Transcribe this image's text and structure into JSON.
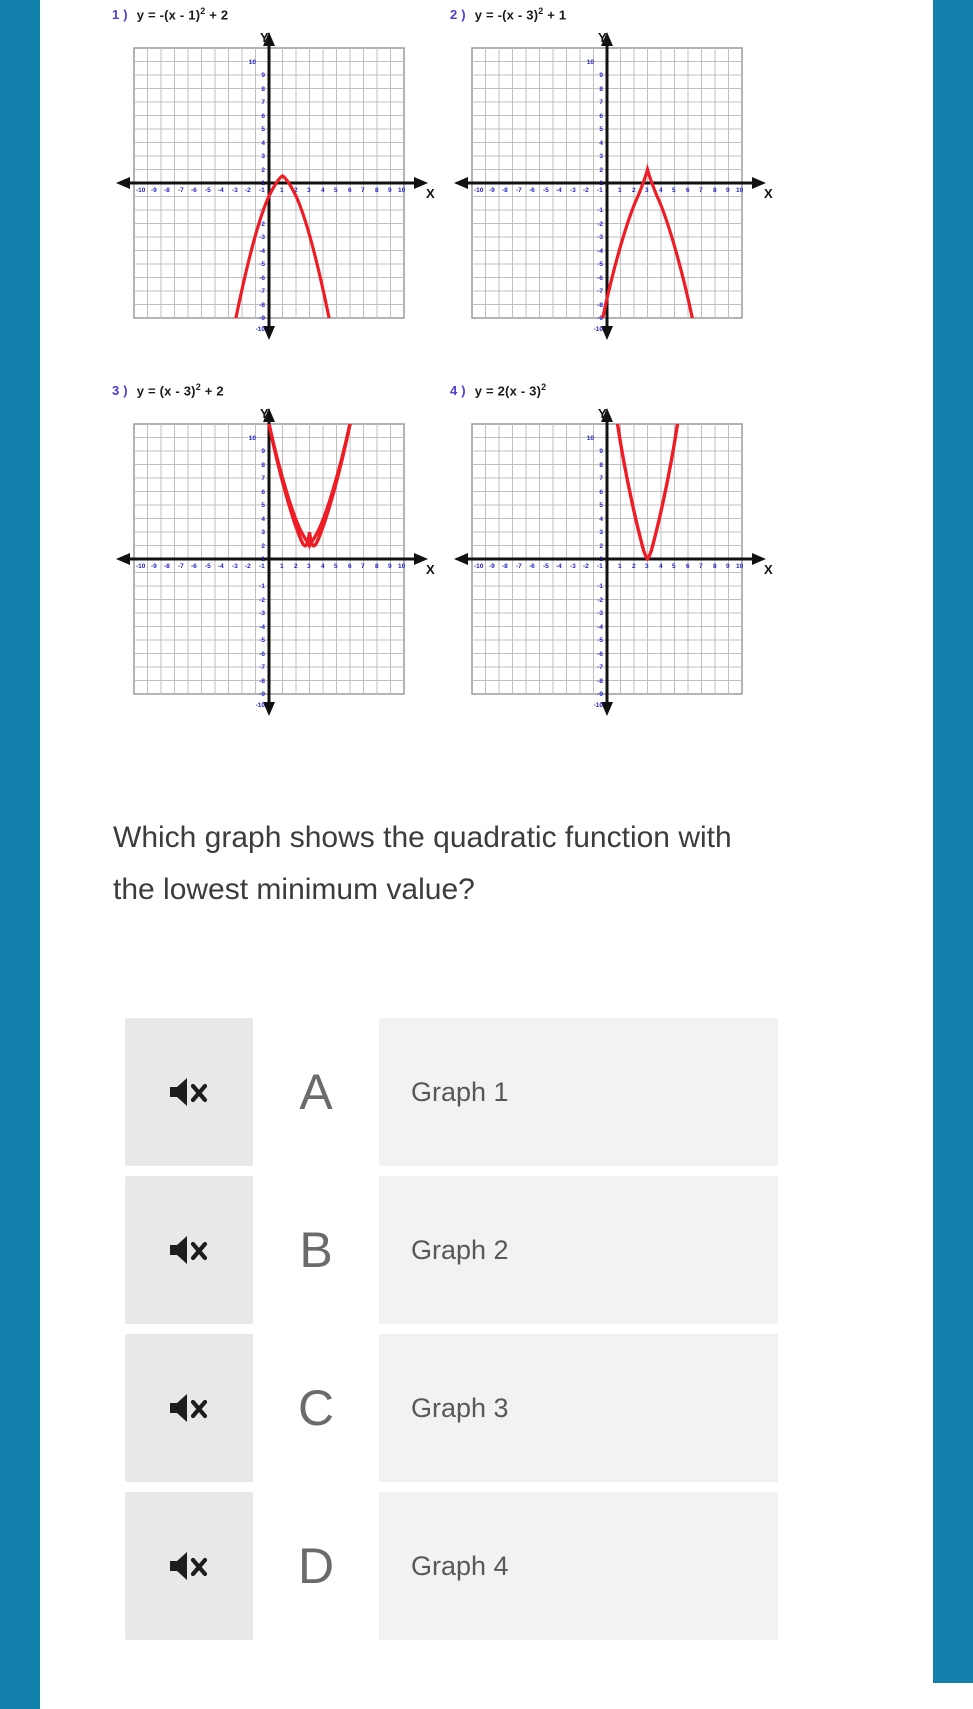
{
  "theme": {
    "rail_color": "#1180ab",
    "curve_color": "#ee1c25",
    "label_blue": "#4a3fd0",
    "tick_blue": "#2222cc",
    "grid_color": "#b3b3b3",
    "axis_color": "#1a1a1a",
    "question_color": "#3c3c3c"
  },
  "worksheet": {
    "axis_labels": {
      "x": "X",
      "y": "Y"
    },
    "graphs": [
      {
        "number": "1 )",
        "equation_prefix": "y = -(x - 1)",
        "equation_exponent": "2",
        "equation_suffix": " + 2",
        "equation_plain": "y = -(x - 1)^2 + 2"
      },
      {
        "number": "2 )",
        "equation_prefix": "y = -(x - 3)",
        "equation_exponent": "2",
        "equation_suffix": " + 1",
        "equation_plain": "y = -(x - 3)^2 + 1"
      },
      {
        "number": "3 )",
        "equation_prefix": "y = (x - 3)",
        "equation_exponent": "2",
        "equation_suffix": " + 2",
        "equation_plain": "y = (x - 3)^2 + 2"
      },
      {
        "number": "4 )",
        "equation_prefix": "y = 2(x - 3)",
        "equation_exponent": "2",
        "equation_suffix": "",
        "equation_plain": "y = 2(x - 3)^2"
      }
    ]
  },
  "chart_data": [
    {
      "type": "line",
      "title": "y = -(x - 1)^2 + 2",
      "xlabel": "X",
      "ylabel": "Y",
      "xlim": [
        -10,
        10
      ],
      "ylim": [
        -10,
        10
      ],
      "grid": true,
      "x_ticks": [
        -10,
        -9,
        -8,
        -7,
        -6,
        -5,
        -4,
        -3,
        -2,
        -1,
        1,
        2,
        3,
        4,
        5,
        6,
        7,
        8,
        9,
        10
      ],
      "y_ticks": [
        -10,
        -9,
        -8,
        -7,
        -6,
        -5,
        -4,
        -3,
        -2,
        -1,
        1,
        2,
        3,
        4,
        5,
        6,
        7,
        8,
        9,
        10
      ],
      "function": {
        "a": -1,
        "h": 1,
        "k": 2
      },
      "vertex": [
        1,
        2
      ],
      "opens": "down",
      "x_intercepts": [
        -0.41,
        2.41
      ]
    },
    {
      "type": "line",
      "title": "y = -(x - 3)^2 + 1",
      "xlabel": "X",
      "ylabel": "Y",
      "xlim": [
        -10,
        10
      ],
      "ylim": [
        -10,
        10
      ],
      "grid": true,
      "x_ticks": [
        -10,
        -9,
        -8,
        -7,
        -6,
        -5,
        -4,
        -3,
        -2,
        -1,
        1,
        2,
        3,
        4,
        5,
        6,
        7,
        8,
        9,
        10
      ],
      "y_ticks": [
        -10,
        -9,
        -8,
        -7,
        -6,
        -5,
        -4,
        -3,
        -2,
        -1,
        1,
        2,
        3,
        4,
        5,
        6,
        7,
        8,
        9,
        10
      ],
      "function": {
        "a": -1,
        "h": 3,
        "k": 1
      },
      "vertex": [
        3,
        1
      ],
      "opens": "down",
      "x_intercepts": [
        2,
        4
      ]
    },
    {
      "type": "line",
      "title": "y = (x - 3)^2 + 2",
      "xlabel": "X",
      "ylabel": "Y",
      "xlim": [
        -10,
        10
      ],
      "ylim": [
        -10,
        10
      ],
      "grid": true,
      "x_ticks": [
        -10,
        -9,
        -8,
        -7,
        -6,
        -5,
        -4,
        -3,
        -2,
        -1,
        1,
        2,
        3,
        4,
        5,
        6,
        7,
        8,
        9,
        10
      ],
      "y_ticks": [
        -10,
        -9,
        -8,
        -7,
        -6,
        -5,
        -4,
        -3,
        -2,
        -1,
        1,
        2,
        3,
        4,
        5,
        6,
        7,
        8,
        9,
        10
      ],
      "function": {
        "a": 1,
        "h": 3,
        "k": 2
      },
      "vertex": [
        3,
        2
      ],
      "opens": "up",
      "x_intercepts": []
    },
    {
      "type": "line",
      "title": "y = 2(x - 3)^2",
      "xlabel": "X",
      "ylabel": "Y",
      "xlim": [
        -10,
        10
      ],
      "ylim": [
        -10,
        10
      ],
      "grid": true,
      "x_ticks": [
        -10,
        -9,
        -8,
        -7,
        -6,
        -5,
        -4,
        -3,
        -2,
        -1,
        1,
        2,
        3,
        4,
        5,
        6,
        7,
        8,
        9,
        10
      ],
      "y_ticks": [
        -10,
        -9,
        -8,
        -7,
        -6,
        -5,
        -4,
        -3,
        -2,
        -1,
        1,
        2,
        3,
        4,
        5,
        6,
        7,
        8,
        9,
        10
      ],
      "function": {
        "a": 2,
        "h": 3,
        "k": 0
      },
      "vertex": [
        3,
        0
      ],
      "opens": "up",
      "x_intercepts": [
        3
      ]
    }
  ],
  "question": {
    "text": "Which graph shows the quadratic function with the lowest minimum value?"
  },
  "answers": {
    "options": [
      {
        "letter": "A",
        "label": "Graph 1",
        "audio_icon": "speaker-muted-icon"
      },
      {
        "letter": "B",
        "label": "Graph 2",
        "audio_icon": "speaker-muted-icon"
      },
      {
        "letter": "C",
        "label": "Graph 3",
        "audio_icon": "speaker-muted-icon"
      },
      {
        "letter": "D",
        "label": "Graph 4",
        "audio_icon": "speaker-muted-icon"
      }
    ]
  }
}
